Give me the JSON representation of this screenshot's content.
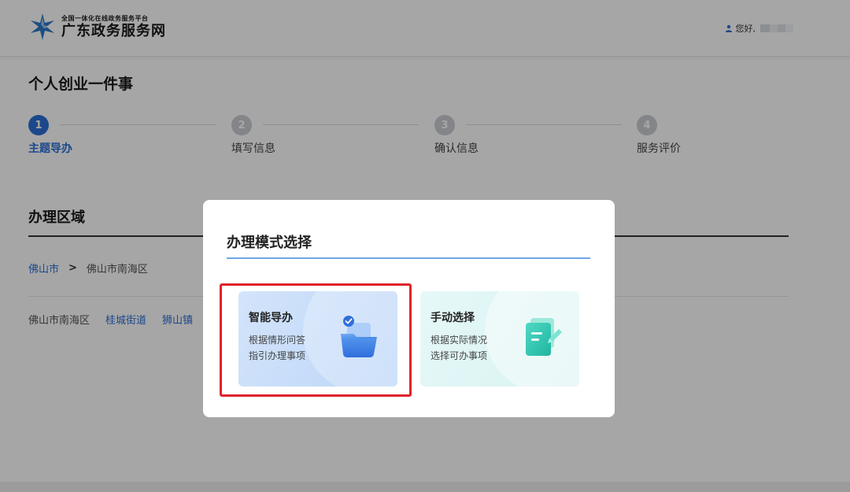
{
  "header": {
    "logo_subtitle": "全国一体化在线政务服务平台",
    "logo_title": "广东政务服务网",
    "greeting": "您好,"
  },
  "page": {
    "title": "个人创业一件事"
  },
  "steps": [
    {
      "number": "1",
      "label": "主题导办",
      "active": true
    },
    {
      "number": "2",
      "label": "填写信息",
      "active": false
    },
    {
      "number": "3",
      "label": "确认信息",
      "active": false
    },
    {
      "number": "4",
      "label": "服务评价",
      "active": false
    }
  ],
  "region": {
    "section_title": "办理区域",
    "breadcrumb": {
      "city": "佛山市",
      "separator": ">",
      "district": "佛山市南海区"
    },
    "areas": [
      {
        "label": "佛山市南海区",
        "link": false
      },
      {
        "label": "桂城街道",
        "link": true
      },
      {
        "label": "狮山镇",
        "link": true
      }
    ]
  },
  "modal": {
    "title": "办理模式选择",
    "options": {
      "smart": {
        "title": "智能导办",
        "description": "根据情形问答\n指引办理事项"
      },
      "manual": {
        "title": "手动选择",
        "description": "根据实际情况\n选择可办事项"
      }
    }
  },
  "colors": {
    "accent": "#2c6fd6",
    "highlight": "#e0232a",
    "step_inactive": "#c9ccd1"
  },
  "icons": {
    "logo": "star-logo-icon",
    "user": "user-icon",
    "smart": "folder-check-icon",
    "manual": "document-pen-icon"
  }
}
